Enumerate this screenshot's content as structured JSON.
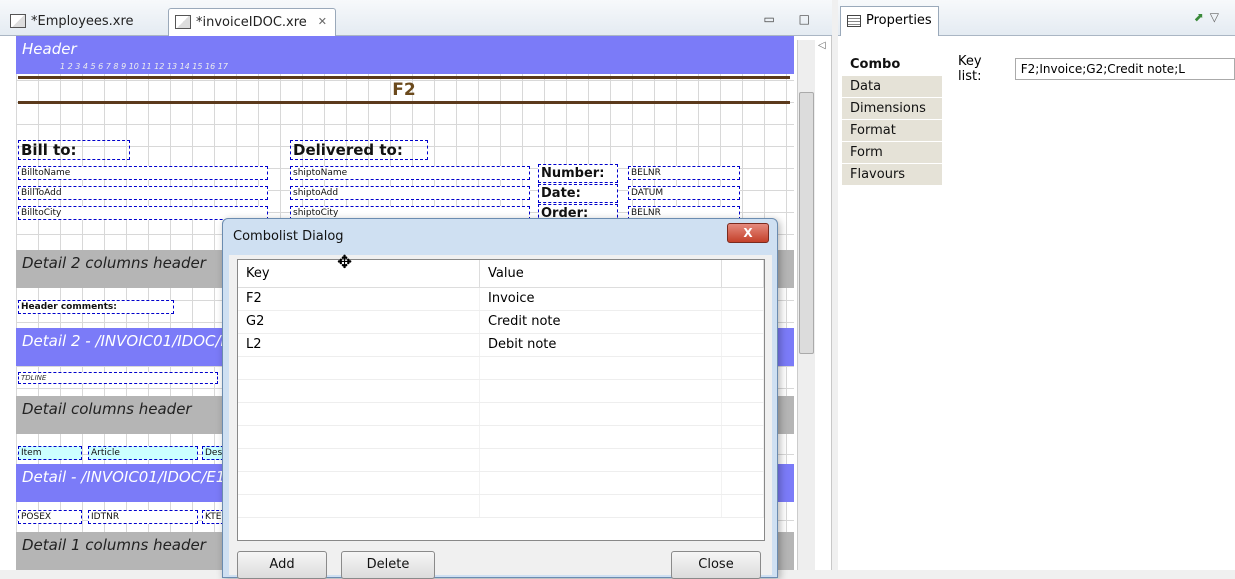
{
  "tabs": [
    {
      "label": "*Employees.xre"
    },
    {
      "label": "*invoiceIDOC.xre",
      "close": "✕"
    }
  ],
  "editor_controls": {
    "minimize": "▭",
    "maximize": "□"
  },
  "report": {
    "header_band": "Header",
    "ruler": "1 2 3 4 5 6 7 8 9 10 11 12 13 14 15 16 17",
    "title_field": "F2",
    "bill_to": "Bill to:",
    "delivered_to": "Delivered to:",
    "bill_fields": [
      "BilltoName",
      "BillToAdd",
      "BilltoCity"
    ],
    "ship_fields": [
      "shiptoName",
      "shiptoAdd",
      "shiptoCity"
    ],
    "number_label": "Number:",
    "date_label": "Date:",
    "order_label": "Order:",
    "number_value": "BELNR",
    "date_value": "DATUM",
    "order_value": "BELNR",
    "band_detail2_hdr": "Detail 2 columns header",
    "header_comments": "Header comments:",
    "band_detail2": "Detail 2 - /INVOIC01/IDOC/I",
    "tdline": "TDLINE",
    "band_detail_cols": "Detail columns header",
    "item_labels": [
      "Item",
      "Article",
      "Des"
    ],
    "band_detail": "Detail - /INVOIC01/IDOC/E1",
    "detail_fields": [
      "POSEX",
      "IDTNR",
      "KTE"
    ],
    "band_detail1_hdr": "Detail 1 columns header"
  },
  "properties": {
    "tab_label": "Properties",
    "side_items": [
      "Combo",
      "Data",
      "Dimensions",
      "Format",
      "Form",
      "Flavours"
    ],
    "key_list_label": "Key list:",
    "key_list_value": "F2;Invoice;G2;Credit note;L"
  },
  "dialog": {
    "title": "Combolist Dialog",
    "close_glyph": "X",
    "col_key": "Key",
    "col_value": "Value",
    "rows": [
      {
        "key": "F2",
        "value": "Invoice"
      },
      {
        "key": "G2",
        "value": "Credit note"
      },
      {
        "key": "L2",
        "value": "Debit note"
      }
    ],
    "add_label": "Add",
    "delete_label": "Delete",
    "close_label": "Close"
  }
}
